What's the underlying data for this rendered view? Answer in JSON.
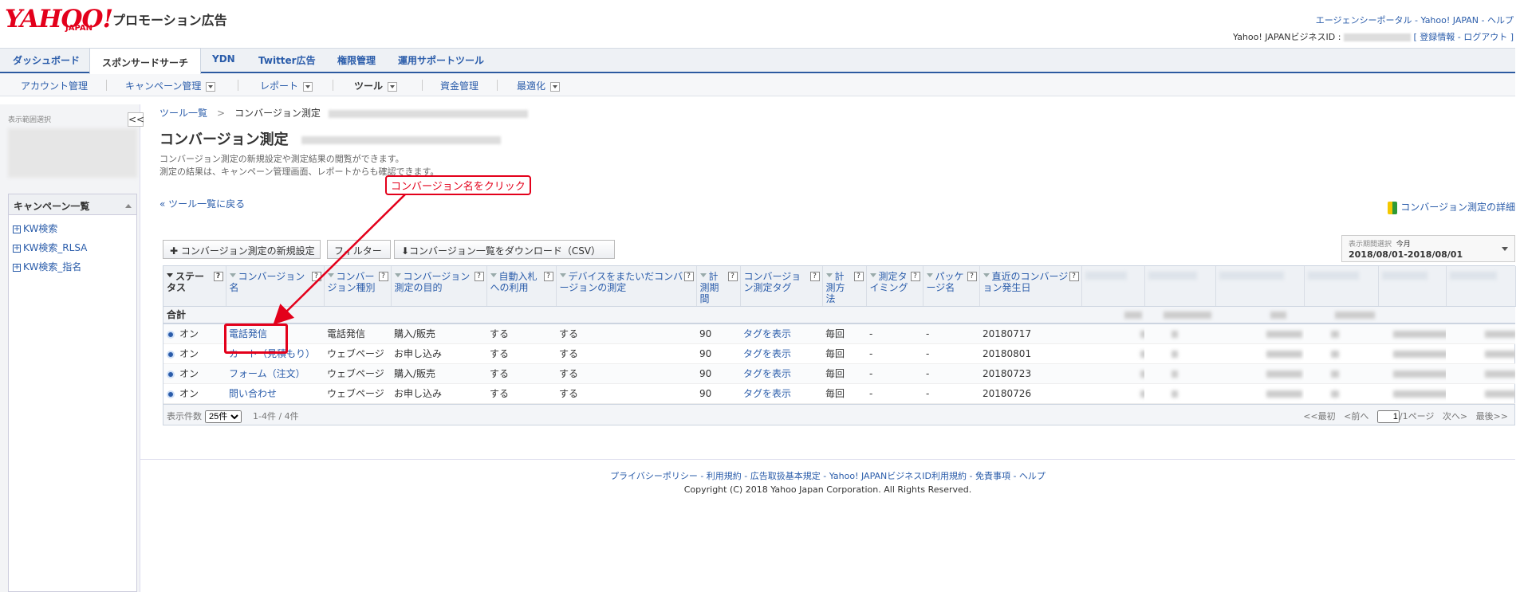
{
  "header": {
    "logo": "YAHOO!",
    "logo_sub": "JAPAN",
    "brand": "プロモーション広告",
    "top_links": "エージェンシーポータル - Yahoo! JAPAN - ヘルプ",
    "business_id_label": "Yahoo! JAPANビジネスID :",
    "account_links": "[ 登録情報 - ログアウト ]"
  },
  "tabs": [
    "ダッシュボード",
    "スポンサードサーチ",
    "YDN",
    "Twitter広告",
    "権限管理",
    "運用サポートツール"
  ],
  "active_tab": "スポンサードサーチ",
  "subnav": [
    "アカウント管理",
    "キャンペーン管理",
    "レポート",
    "ツール",
    "資金管理",
    "最適化"
  ],
  "sidebar": {
    "scope_label": "表示範囲選択",
    "collapse": "<<",
    "campaign_title": "キャンペーン一覧",
    "campaigns": [
      "KW検索",
      "KW検索_RLSA",
      "KW検索_指名"
    ]
  },
  "breadcrumb": {
    "root": "ツール一覧",
    "sep": ">",
    "current": "コンバージョン測定"
  },
  "page": {
    "title": "コンバージョン測定",
    "desc1": "コンバージョン測定の新規設定や測定結果の閲覧ができます。",
    "desc2": "測定の結果は、キャンペーン管理画面、レポートからも確認できます。",
    "back": "« ツール一覧に戻る",
    "detail_link": "コンバージョン測定の詳細"
  },
  "toolbar": {
    "new": "✚ コンバージョン測定の新規設定",
    "filter": "フィルター",
    "download": "⬇コンバージョン一覧をダウンロード（CSV）"
  },
  "period": {
    "label": "表示期間選択",
    "preset": "今月",
    "range": "2018/08/01-2018/08/01"
  },
  "table": {
    "headers": [
      "ステータス",
      "コンバージョン名",
      "コンバージョン種別",
      "コンバージョン測定の目的",
      "自動入札への利用",
      "デバイスをまたいだコンバージョンの測定",
      "計測期間",
      "コンバージョン測定タグ",
      "計測方法",
      "測定タイミング",
      "パッケージ名",
      "直近のコンバージョン発生日"
    ],
    "total_label": "合計",
    "rows": [
      {
        "status": "オン",
        "name": "電話発信",
        "type": "電話発信",
        "purpose": "購入/販売",
        "auto": "する",
        "cross": "する",
        "period": "90",
        "tag": "タグを表示",
        "method": "毎回",
        "timing": "-",
        "pkg": "-",
        "date": "20180717"
      },
      {
        "status": "オン",
        "name": "カート（見積もり）",
        "type": "ウェブページ",
        "purpose": "お申し込み",
        "auto": "する",
        "cross": "する",
        "period": "90",
        "tag": "タグを表示",
        "method": "毎回",
        "timing": "-",
        "pkg": "-",
        "date": "20180801"
      },
      {
        "status": "オン",
        "name": "フォーム（注文）",
        "type": "ウェブページ",
        "purpose": "購入/販売",
        "auto": "する",
        "cross": "する",
        "period": "90",
        "tag": "タグを表示",
        "method": "毎回",
        "timing": "-",
        "pkg": "-",
        "date": "20180723"
      },
      {
        "status": "オン",
        "name": "問い合わせ",
        "type": "ウェブページ",
        "purpose": "お申し込み",
        "auto": "する",
        "cross": "する",
        "period": "90",
        "tag": "タグを表示",
        "method": "毎回",
        "timing": "-",
        "pkg": "-",
        "date": "20180726"
      }
    ],
    "per_page_label": "表示件数",
    "per_page": "25件",
    "range": "1-4件 / 4件",
    "first": "<<最初",
    "prev": "<前へ",
    "page": "1",
    "pages": "/1ページ",
    "next": "次へ>",
    "last": "最後>>"
  },
  "annotation": {
    "callout": "コンバージョン名をクリック"
  },
  "footer": {
    "links": "プライバシーポリシー - 利用規約 - 広告取扱基本規定 - Yahoo! JAPANビジネスID利用規約 - 免責事項 - ヘルプ",
    "copyright": "Copyright (C) 2018 Yahoo Japan Corporation. All Rights Reserved."
  },
  "colors": {
    "accent": "#2a5caa",
    "brand_red": "#e3001b"
  }
}
